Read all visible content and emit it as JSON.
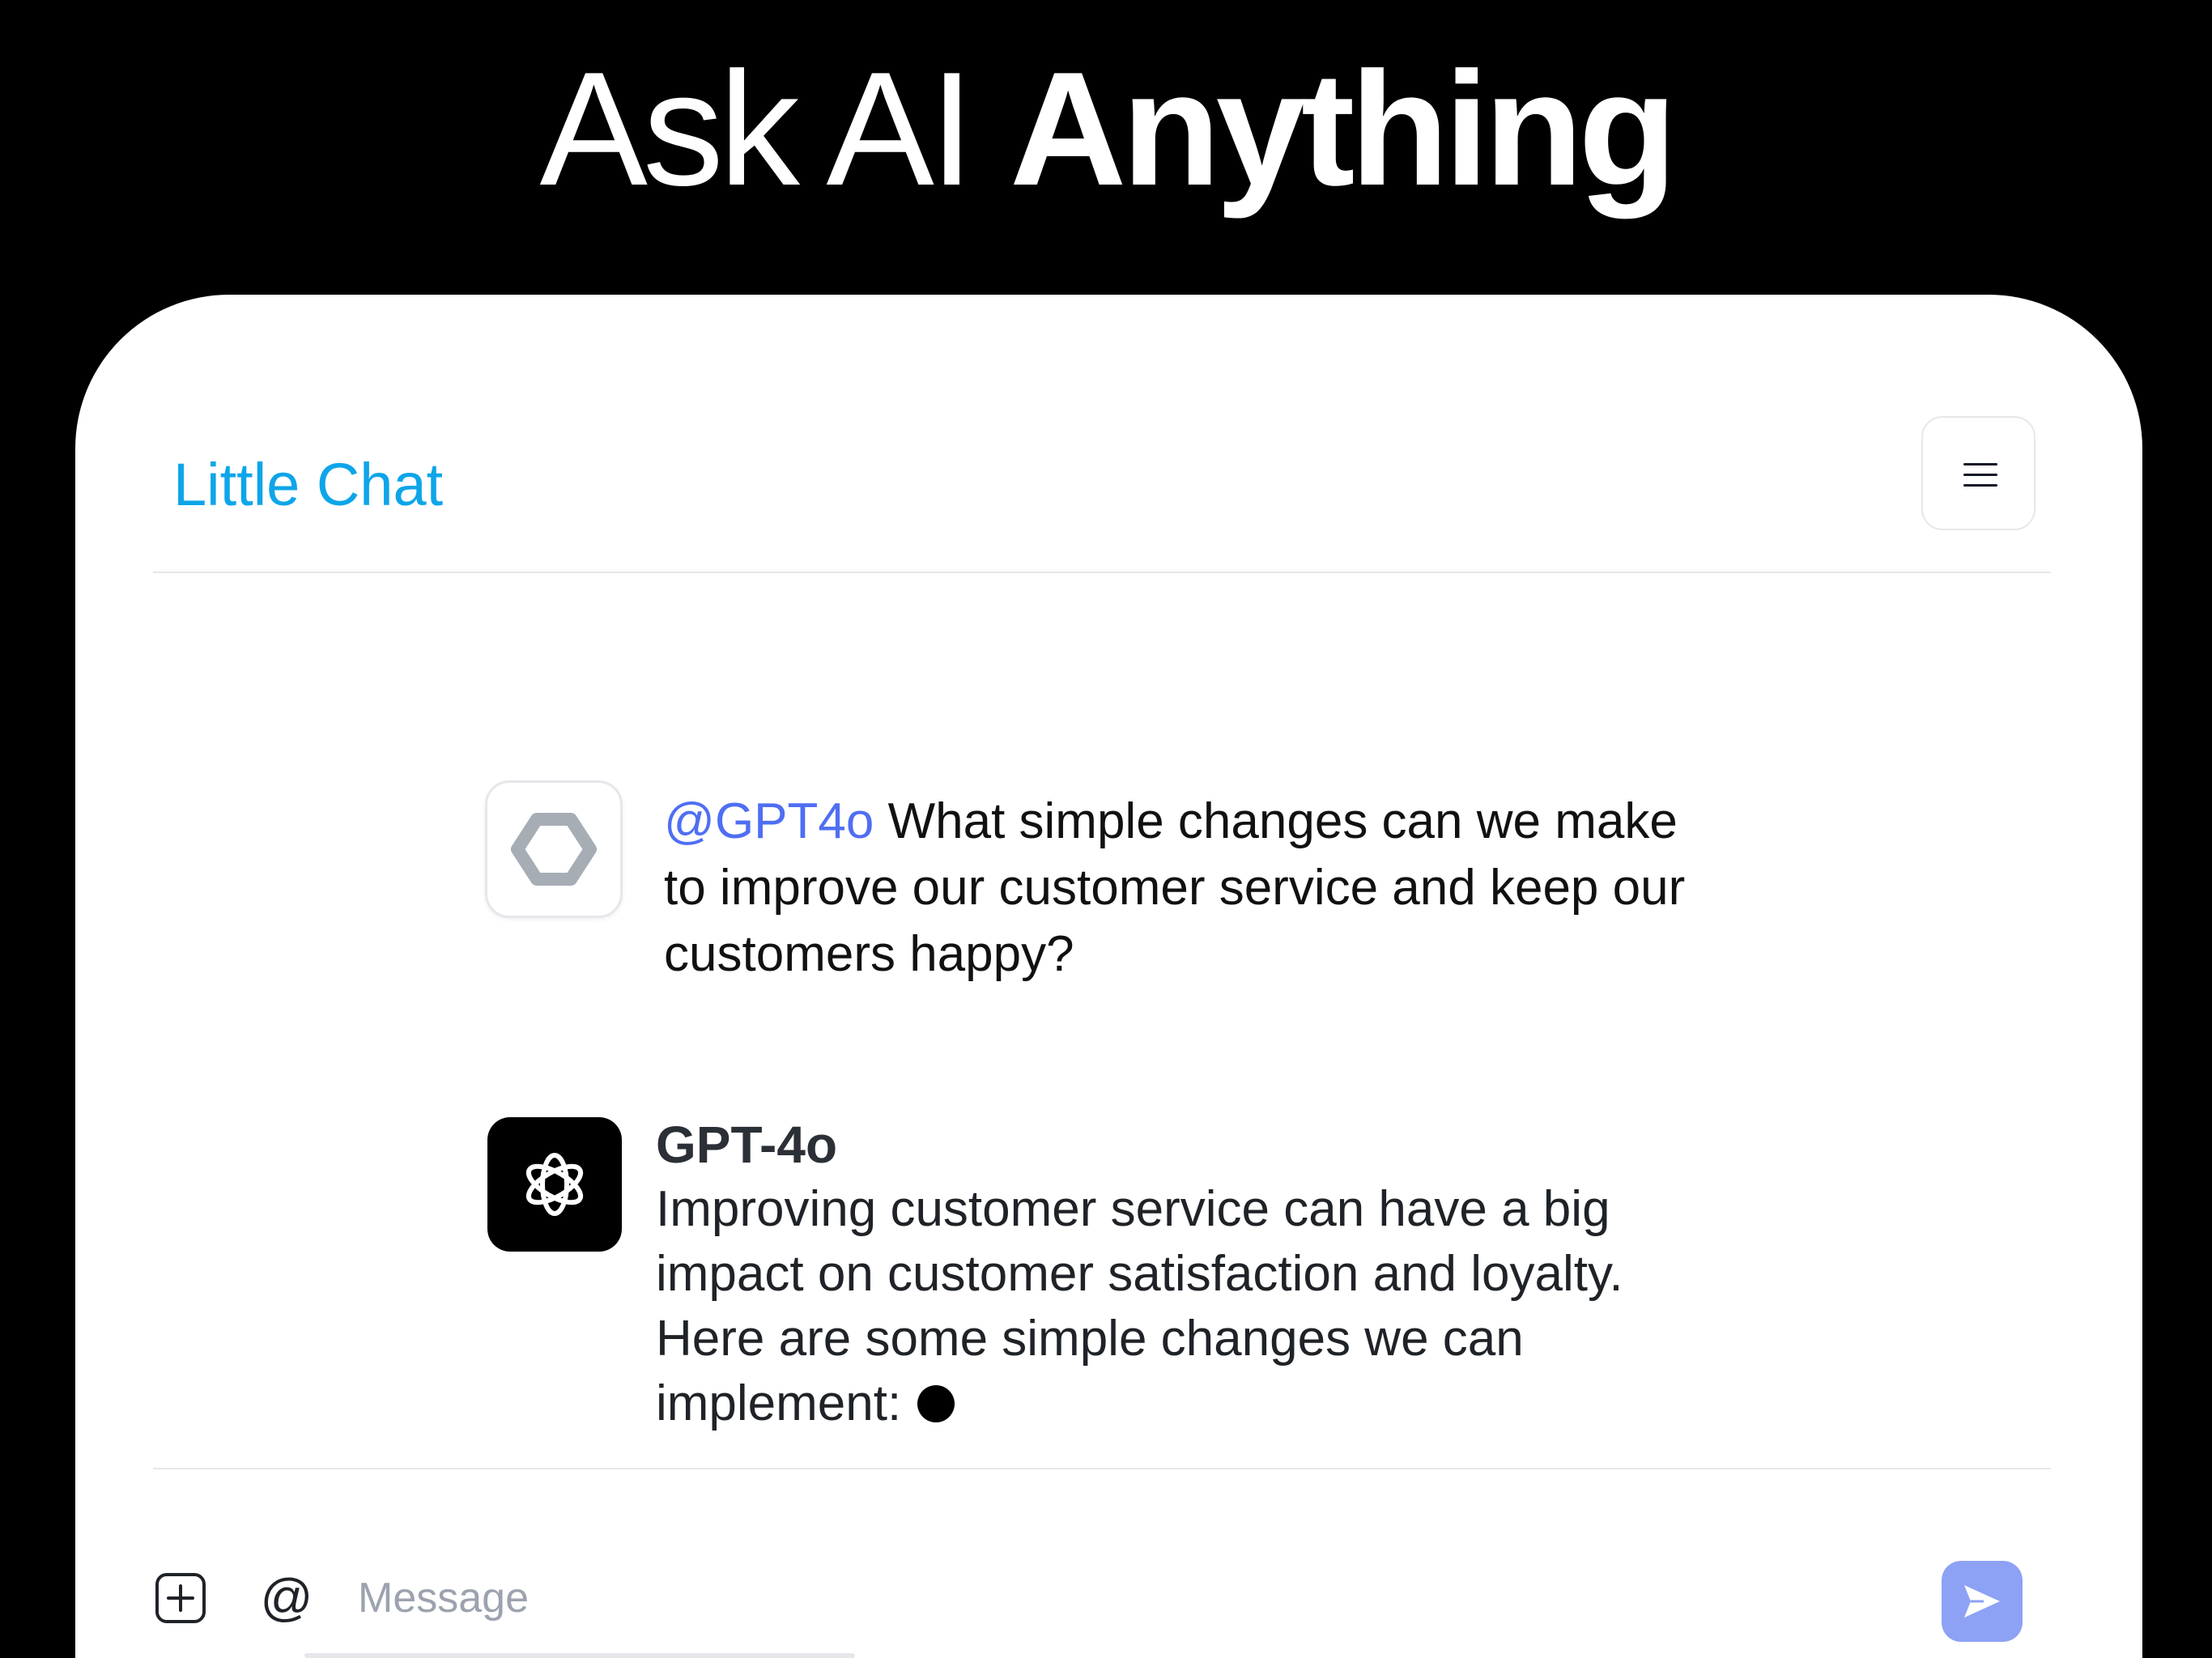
{
  "hero": {
    "title_light": "Ask AI",
    "title_bold": "Anything"
  },
  "app": {
    "title": "Little Chat",
    "menu_icon": "hamburger-menu-icon",
    "accent_color": "#0ea5e9"
  },
  "messages": [
    {
      "role": "user",
      "avatar_icon": "hexagon-logo-icon",
      "mention": "@GPT4o",
      "text": "What simple changes can we make to improve our customer service and keep our customers happy?"
    },
    {
      "role": "assistant",
      "avatar_icon": "openai-logo-icon",
      "name": "GPT-4o",
      "text": "Improving customer service can have a big impact on customer satisfaction and loyalty. Here are some simple changes we can implement:",
      "status": "typing"
    }
  ],
  "composer": {
    "attach_icon": "plus-square-icon",
    "mention_label": "@",
    "placeholder": "Message",
    "value": "",
    "send_icon": "send-icon",
    "send_color": "#8da2f5"
  }
}
